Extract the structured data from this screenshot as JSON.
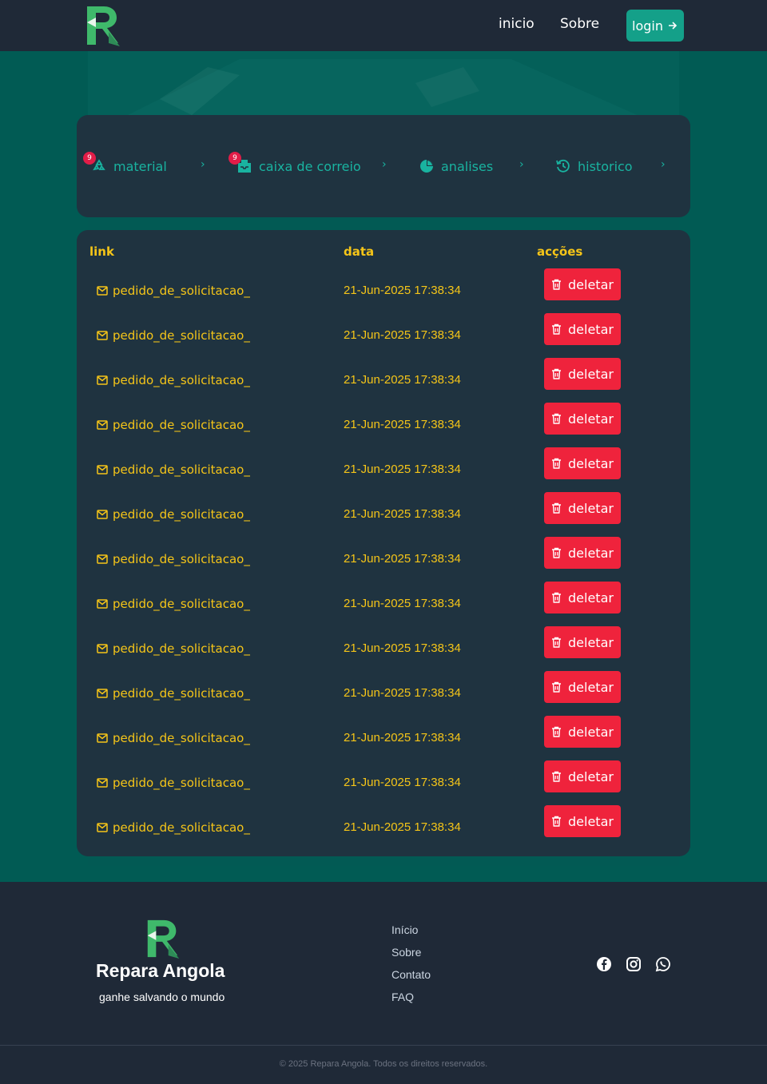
{
  "nav": {
    "links": [
      "inicio",
      "Sobre"
    ],
    "login_label": "login"
  },
  "tabs": [
    {
      "label": "material",
      "icon": "recycle-icon",
      "badge": "9"
    },
    {
      "label": "caixa de correio",
      "icon": "inbox-icon",
      "badge": "9"
    },
    {
      "label": "analises",
      "icon": "pie-chart-icon",
      "badge": null
    },
    {
      "label": "historico",
      "icon": "history-icon",
      "badge": null
    }
  ],
  "table": {
    "headers": {
      "link": "link",
      "data": "data",
      "acoes": "acções"
    },
    "delete_label": "deletar",
    "rows": [
      {
        "link": "pedido_de_solicitacao_",
        "date": "21-Jun-2025 17:38:34"
      },
      {
        "link": "pedido_de_solicitacao_",
        "date": "21-Jun-2025 17:38:34"
      },
      {
        "link": "pedido_de_solicitacao_",
        "date": "21-Jun-2025 17:38:34"
      },
      {
        "link": "pedido_de_solicitacao_",
        "date": "21-Jun-2025 17:38:34"
      },
      {
        "link": "pedido_de_solicitacao_",
        "date": "21-Jun-2025 17:38:34"
      },
      {
        "link": "pedido_de_solicitacao_",
        "date": "21-Jun-2025 17:38:34"
      },
      {
        "link": "pedido_de_solicitacao_",
        "date": "21-Jun-2025 17:38:34"
      },
      {
        "link": "pedido_de_solicitacao_",
        "date": "21-Jun-2025 17:38:34"
      },
      {
        "link": "pedido_de_solicitacao_",
        "date": "21-Jun-2025 17:38:34"
      },
      {
        "link": "pedido_de_solicitacao_",
        "date": "21-Jun-2025 17:38:34"
      },
      {
        "link": "pedido_de_solicitacao_",
        "date": "21-Jun-2025 17:38:34"
      },
      {
        "link": "pedido_de_solicitacao_",
        "date": "21-Jun-2025 17:38:34"
      },
      {
        "link": "pedido_de_solicitacao_",
        "date": "21-Jun-2025 17:38:34"
      }
    ]
  },
  "footer": {
    "brand": "Repara Angola",
    "tagline": "ganhe salvando o mundo",
    "links": [
      "Início",
      "Sobre",
      "Contato",
      "FAQ"
    ],
    "social_icons": [
      "facebook-icon",
      "instagram-icon",
      "whatsapp-icon"
    ],
    "copyright": "© 2025 Repara Angola. Todos os direitos reservados."
  },
  "colors": {
    "navbar": "#1f2937",
    "background": "#015b54",
    "card": "#1f3340",
    "accent_teal": "#19b3a0",
    "text_yellow": "#f5c518",
    "delete_red": "#ef233c",
    "badge_pink": "#e11d48"
  }
}
